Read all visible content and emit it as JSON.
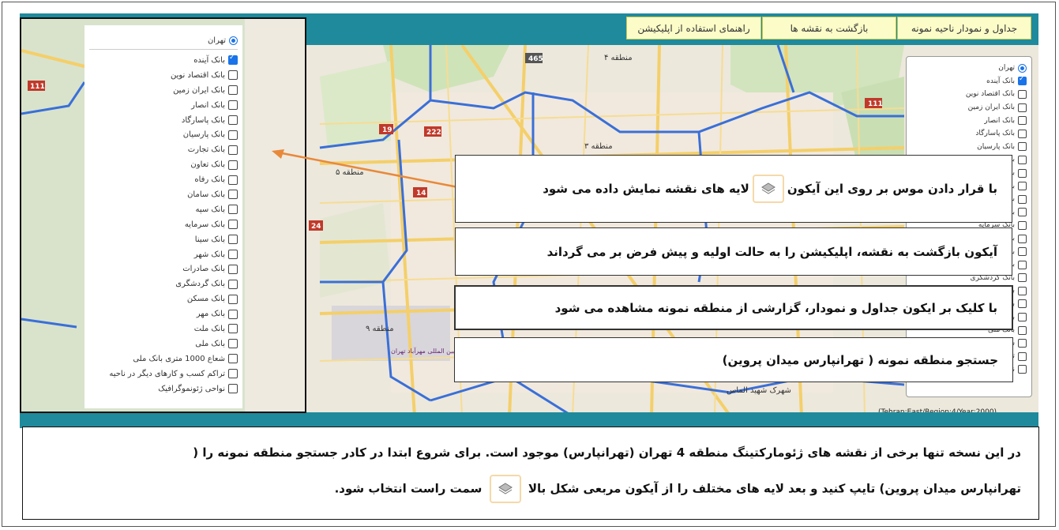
{
  "header": {
    "buttons": [
      {
        "label": "جداول و نمودار ناحیه نمونه"
      },
      {
        "label": "بازگشت به نقشه ها"
      },
      {
        "label": "راهنمای استفاده از اپلیکیشن"
      }
    ]
  },
  "layers": {
    "city": "تهران",
    "items": [
      {
        "label": "بانک آینده",
        "checked": true
      },
      {
        "label": "بانک اقتصاد نوین",
        "checked": false
      },
      {
        "label": "بانک ایران زمین",
        "checked": false
      },
      {
        "label": "بانک انصار",
        "checked": false
      },
      {
        "label": "بانک پاسارگاد",
        "checked": false
      },
      {
        "label": "بانک پارسیان",
        "checked": false
      },
      {
        "label": "بانک تجارت",
        "checked": false
      },
      {
        "label": "بانک تعاون",
        "checked": false
      },
      {
        "label": "بانک رفاه",
        "checked": false
      },
      {
        "label": "بانک سامان",
        "checked": false
      },
      {
        "label": "بانک سپه",
        "checked": false
      },
      {
        "label": "بانک سرمایه",
        "checked": false
      },
      {
        "label": "بانک سینا",
        "checked": false
      },
      {
        "label": "بانک شهر",
        "checked": false
      },
      {
        "label": "بانک صادرات",
        "checked": false
      },
      {
        "label": "بانک گردشگری",
        "checked": false
      },
      {
        "label": "بانک مسکن",
        "checked": false
      },
      {
        "label": "بانک مهر",
        "checked": false
      },
      {
        "label": "بانک ملت",
        "checked": false
      },
      {
        "label": "بانک ملی",
        "checked": false
      },
      {
        "label": "شعاع 1000 متری بانک ملی",
        "checked": false
      },
      {
        "label": "تراکم کسب و کارهای دیگر در ناحیه",
        "checked": false
      },
      {
        "label": "نواحی ژئونموگرافیک",
        "checked": false
      }
    ]
  },
  "map": {
    "labels": {
      "road_465": "465",
      "road_111a": "111",
      "road_111b": "111",
      "road_19": "19",
      "road_222": "222",
      "road_14": "14",
      "road_24": "24",
      "region_4": "منطقه ۴",
      "region_3": "منطقه ۳",
      "region_5": "منطقه ۵",
      "region_9": "منطقه ۹",
      "airport": "فرودگاه بین المللی مهرآباد تهران",
      "town": "شهرک شهید الماس",
      "attribution": "(Tehran:East/Region:4/Year:2000)"
    }
  },
  "callouts": {
    "hover_before": "با قرار دادن موس بر روی این آیکون",
    "hover_after": "لایه های نقشه نمایش داده می شود",
    "back": "آیکون بازگشت به نقشه، اپلیکیشن را به حالت اولیه و پیش فرض بر می گرداند",
    "tables": "با کلیک بر ایکون جداول و نمودار، گزارشی از منطقه نمونه مشاهده می شود",
    "search": "جستجو منطقه نمونه ( تهرانپارس میدان پروین)"
  },
  "note": {
    "line1": "در این نسخه تنها برخی از نقشه های ژئومارکتینگ  منطقه 4 تهران (تهرانپارس) موجود است. برای شروع ابتدا در کادر جستجو منطقه نمونه را (",
    "line2_before": "تهرانپارس میدان پروین) تایپ کنید و بعد لایه های مختلف را  از  آیکون مربعی شکل بالا",
    "line2_after": "سمت راست انتخاب شود."
  },
  "colors": {
    "header": "#1f8a9c",
    "button_bg": "#fbfcc8",
    "region_border": "#3a6fd8",
    "arrow": "#e8893a"
  }
}
